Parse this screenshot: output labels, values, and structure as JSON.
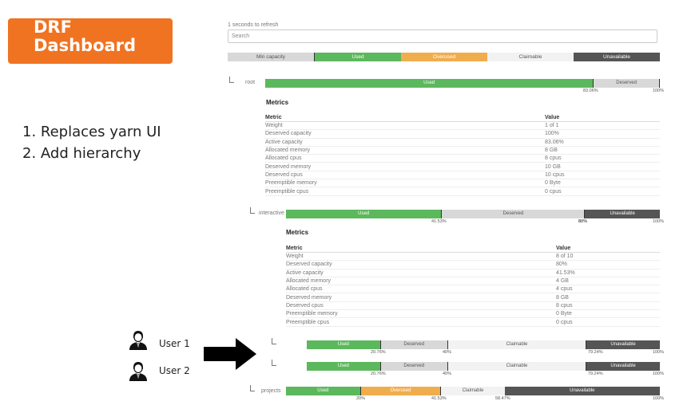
{
  "slide": {
    "title_line1": "DRF",
    "title_line2": "Dashboard",
    "bullet1": "1. Replaces yarn UI",
    "bullet2": "2. Add hierarchy"
  },
  "header": {
    "refresh_text": "1 seconds to refresh",
    "search_placeholder": "Search"
  },
  "legend": [
    "Min capacity",
    "Used",
    "Overused",
    "Claimable",
    "Unavailable"
  ],
  "colors": {
    "used": "#5cb85c",
    "overused": "#f0ad4e",
    "deserved": "#d8d8d8",
    "claimable": "#f2f2f2",
    "unavailable": "#555555",
    "title_bg": "#f07322"
  },
  "root": {
    "label": "root",
    "bar": {
      "used": "Used",
      "deserved": "Deserved"
    },
    "tick_used": "83.06%",
    "tick_end": "100%",
    "metrics_title": "Metrics",
    "col_metric": "Metric",
    "col_value": "Value",
    "rows": [
      [
        "Weight",
        "1 of 1"
      ],
      [
        "Deserved capacity",
        "100%"
      ],
      [
        "Active capacity",
        "83.06%"
      ],
      [
        "Allocated memory",
        "8 GB"
      ],
      [
        "Allocated cpus",
        "8 cpus"
      ],
      [
        "Deserved memory",
        "10 GB"
      ],
      [
        "Deserved cpus",
        "10 cpus"
      ],
      [
        "Preemptible memory",
        "0 Byte"
      ],
      [
        "Preemptible cpus",
        "0 cpus"
      ]
    ]
  },
  "interactive": {
    "label": "interactive",
    "bar": {
      "used": "Used",
      "deserved": "Deserved",
      "unavailable": "Unavailable"
    },
    "tick_used": "41.53%",
    "tick_deserved": "80%",
    "tick_end": "100%",
    "metrics_title": "Metrics",
    "col_metric": "Metric",
    "col_value": "Value",
    "rows": [
      [
        "Weight",
        "8 of 10"
      ],
      [
        "Deserved capacity",
        "80%"
      ],
      [
        "Active capacity",
        "41.53%"
      ],
      [
        "Allocated memory",
        "4 GB"
      ],
      [
        "Allocated cpus",
        "4 cpus"
      ],
      [
        "Deserved memory",
        "8 GB"
      ],
      [
        "Deserved cpus",
        "8 cpus"
      ],
      [
        "Preemptible memory",
        "0 Byte"
      ],
      [
        "Preemptible cpus",
        "0 cpus"
      ]
    ]
  },
  "user_queues": [
    {
      "bar": {
        "used": "Used",
        "deserved": "Deserved",
        "claimable": "Claimable",
        "unavailable": "Unavailable"
      },
      "ticks": [
        "20.76%",
        "40%",
        "79.24%",
        "100%"
      ]
    },
    {
      "bar": {
        "used": "Used",
        "deserved": "Deserved",
        "claimable": "Claimable",
        "unavailable": "Unavailable"
      },
      "ticks": [
        "20.76%",
        "40%",
        "79.24%",
        "100%"
      ]
    }
  ],
  "users": [
    "User 1",
    "User 2"
  ],
  "projects": {
    "label": "projects",
    "bar": {
      "used": "Used",
      "overused": "Overused",
      "claimable": "Claimable",
      "unavailable": "Unavailable"
    },
    "ticks": [
      "20%",
      "41.53%",
      "58.47%",
      "100%"
    ]
  }
}
